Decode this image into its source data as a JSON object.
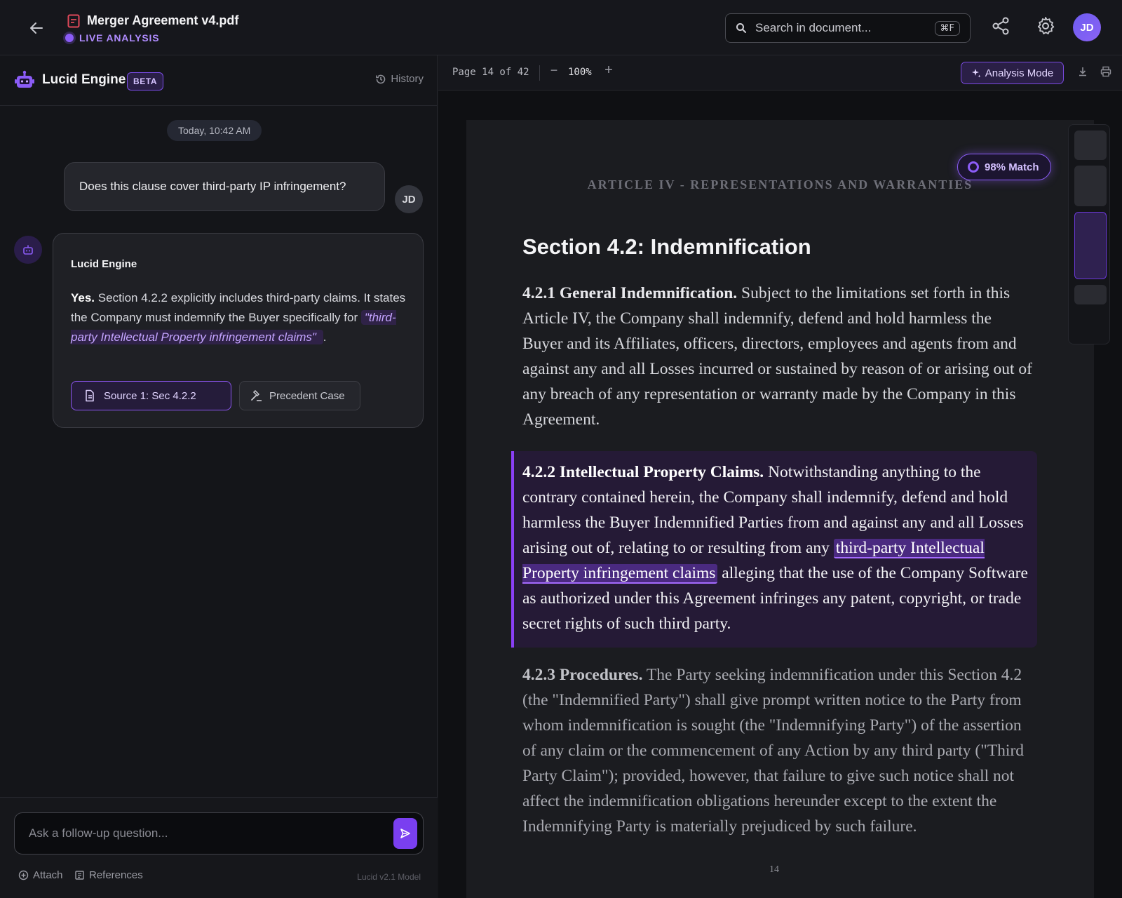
{
  "header": {
    "doc_title": "Merger Agreement v4.pdf",
    "status": "LIVE ANALYSIS",
    "search_placeholder": "Search in document...",
    "search_shortcut": "⌘F",
    "user_initials": "JD",
    "icons": [
      "back-arrow-icon",
      "pdf-file-icon",
      "search-icon",
      "share-icon",
      "gear-icon"
    ]
  },
  "chat": {
    "engine_name": "Lucid Engine",
    "engine_badge": "BETA",
    "history_label": "History",
    "timestamp": "Today, 10:42 AM",
    "user_message": "Does this clause cover third-party IP infringement?",
    "user_initials": "JD",
    "bot_name": "Lucid Engine",
    "answer_lead": "Yes.",
    "answer_body": " Section 4.2.2 explicitly includes third-party claims. It states the Company must indemnify the Buyer specifically for ",
    "answer_quote": " \"third-party Intellectual Property infringement claims\" ",
    "answer_end": ".",
    "source_button": "Source 1: Sec 4.2.2",
    "precedent_button": "Precedent Case",
    "input_placeholder": "Ask a follow-up question...",
    "attach_label": "Attach",
    "references_label": "References",
    "model_label": "Lucid v2.1 Model"
  },
  "viewer": {
    "page_indicator": "Page 14 of 42",
    "zoom_out": "−",
    "zoom": "100%",
    "zoom_in": "+",
    "analysis_mode_label": "Analysis Mode",
    "match_label": "98% Match",
    "article_heading": "ARTICLE IV - REPRESENTATIONS AND WARRANTIES",
    "section_title": "Section 4.2: Indemnification",
    "p1_head": "4.2.1 General Indemnification.",
    "p1_body": " Subject to the limitations set forth in this Article IV, the Company shall indemnify, defend and hold harmless the Buyer and its Affiliates, officers, directors, employees and agents from and against any and all Losses incurred or sustained by reason of or arising out of any breach of any representation or warranty made by the Company in this Agreement.",
    "p2_head": "4.2.2 Intellectual Property Claims.",
    "p2_body_a": " Notwithstanding anything to the contrary contained herein, the Company shall indemnify, defend and hold harmless the Buyer Indemnified Parties from and against any and all Losses arising out of, relating to or resulting from any ",
    "p2_highlight": "third-party Intellectual Property infringement claims",
    "p2_body_b": " alleging that the use of the Company Software as authorized under this Agreement infringes any patent, copyright, or trade secret rights of such third party.",
    "p3_head": "4.2.3 Procedures.",
    "p3_body": " The Party seeking indemnification under this Section 4.2 (the \"Indemnified Party\") shall give prompt written notice to the Party from whom indemnification is sought (the \"Indemnifying Party\") of the assertion of any claim or the commencement of any Action by any third party (\"Third Party Claim\"); provided, however, that failure to give such notice shall not affect the indemnification obligations hereunder except to the extent the Indemnifying Party is materially prejudiced by such failure.",
    "page_number": "14"
  },
  "colors": {
    "accent": "#8b5cf6",
    "background": "#141519",
    "page": "#1b1c20"
  }
}
